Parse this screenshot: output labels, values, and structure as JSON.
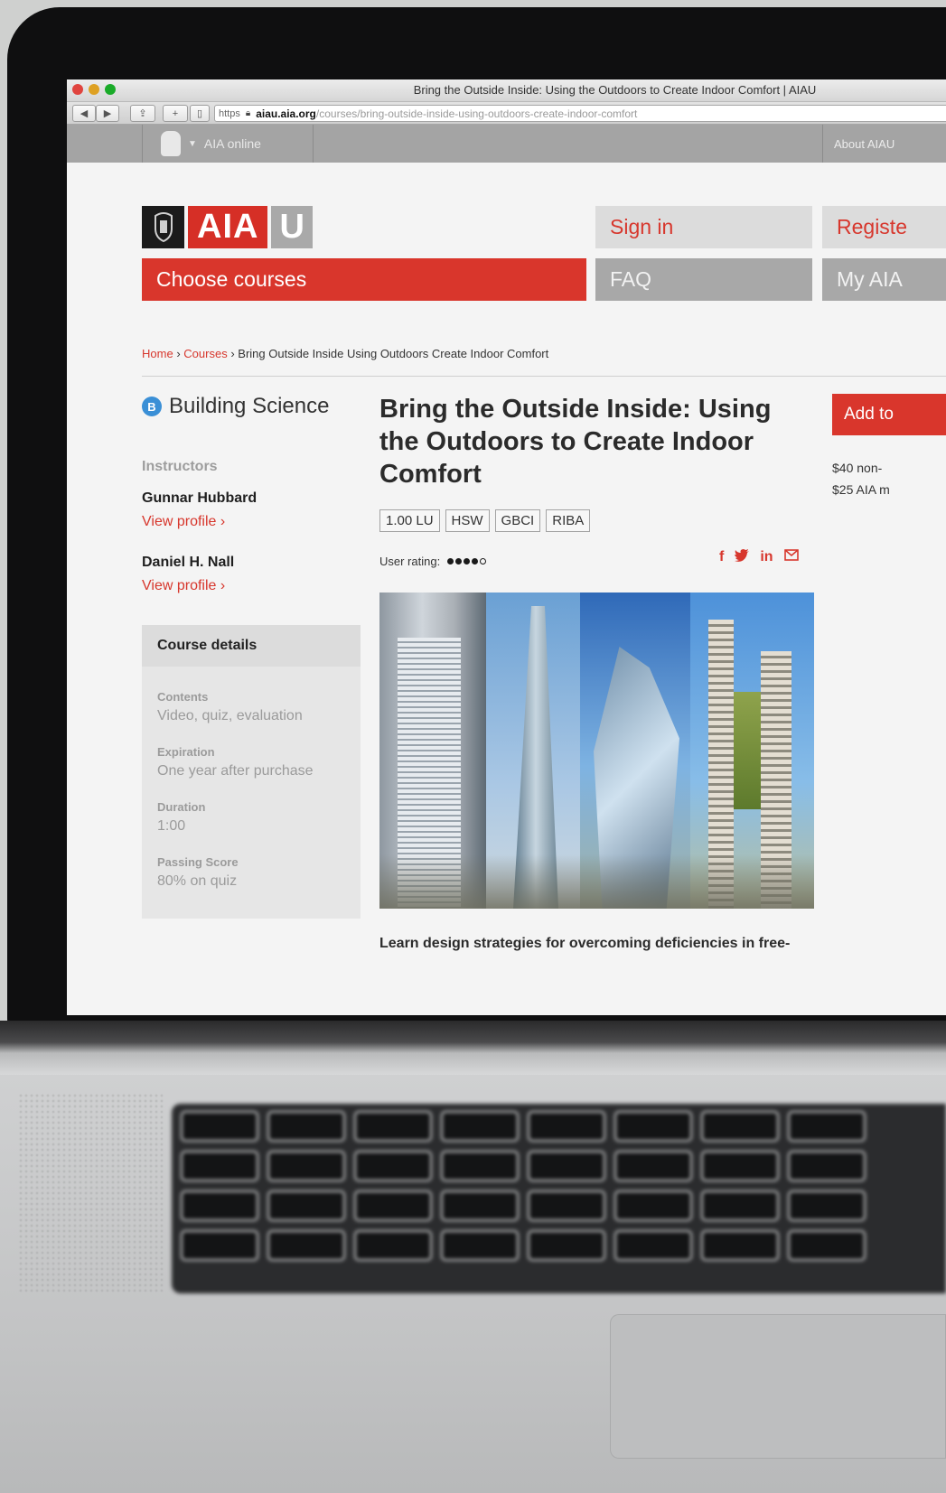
{
  "browser": {
    "window_title": "Bring the Outside Inside: Using the Outdoors to Create Indoor Comfort | AIAU",
    "url_scheme": "https",
    "url_host": "aiau.aia.org",
    "url_path": "/courses/bring-outside-inside-using-outdoors-create-indoor-comfort"
  },
  "topnav": {
    "aia_online": "AIA online",
    "about": "About AIAU"
  },
  "header": {
    "logo_aia": "AIA",
    "logo_u": "U",
    "choose_courses": "Choose courses",
    "sign_in": "Sign in",
    "faq": "FAQ",
    "register": "Registe",
    "my_aia": "My AIA"
  },
  "breadcrumb": {
    "home": "Home",
    "courses": "Courses",
    "current": "Bring Outside Inside Using Outdoors Create Indoor Comfort",
    "sep": "›"
  },
  "sidebar": {
    "category_badge": "B",
    "category": "Building Science",
    "instructors_heading": "Instructors",
    "instructors": [
      {
        "name": "Gunnar Hubbard",
        "link": "View profile ›"
      },
      {
        "name": "Daniel H. Nall",
        "link": "View profile ›"
      }
    ],
    "details_heading": "Course details",
    "details": [
      {
        "label": "Contents",
        "value": "Video, quiz, evaluation"
      },
      {
        "label": "Expiration",
        "value": "One year after purchase"
      },
      {
        "label": "Duration",
        "value": "1:00"
      },
      {
        "label": "Passing Score",
        "value": "80% on quiz"
      }
    ]
  },
  "course": {
    "title": "Bring the Outside Inside: Using the Outdoors to Create Indoor Comfort",
    "tags": [
      "1.00 LU",
      "HSW",
      "GBCI",
      "RIBA"
    ],
    "rating_label": "User rating:",
    "rating_value": 4,
    "rating_max": 5,
    "lede": "Learn design strategies for overcoming deficiencies in free-"
  },
  "purchase": {
    "add_button": "Add to",
    "price_non_member": "$40 non-",
    "price_member": "$25 AIA m"
  },
  "colors": {
    "brand_red": "#d9362c",
    "gray_nav": "#a8a8a8",
    "badge_blue": "#3a8fd6"
  }
}
